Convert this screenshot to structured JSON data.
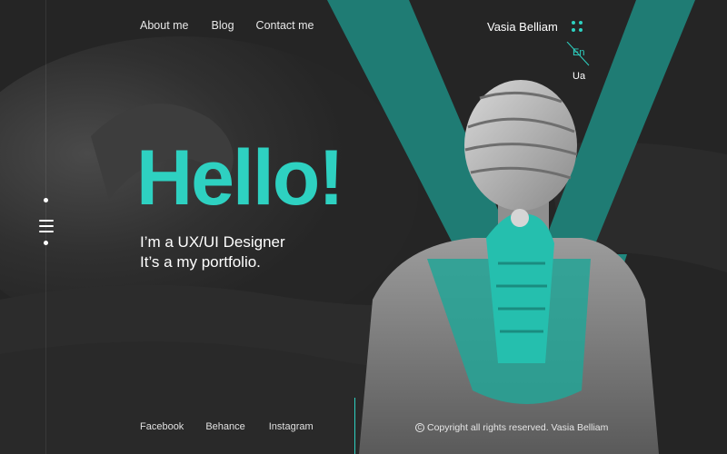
{
  "nav": {
    "items": [
      {
        "label": "About me"
      },
      {
        "label": "Blog"
      },
      {
        "label": "Contact me"
      }
    ]
  },
  "brand": {
    "name": "Vasia Belliam"
  },
  "language": {
    "active": "En",
    "other": "Ua"
  },
  "hero": {
    "title": "Hello!",
    "line1": "I’m a UX/UI Designer",
    "line2": "It’s a my portfolio."
  },
  "social": {
    "items": [
      {
        "label": "Facebook"
      },
      {
        "label": "Behance"
      },
      {
        "label": "Instagram"
      }
    ]
  },
  "footer": {
    "copyright_symbol": "C",
    "copyright": "Copyright all rights reserved. Vasia Belliam"
  },
  "icons": {
    "menu": "hamburger-menu-icon",
    "apps": "four-dots-icon",
    "copyright": "copyright-icon"
  },
  "colors": {
    "accent": "#2ed1c1",
    "background": "#262626",
    "text": "#ffffff"
  }
}
